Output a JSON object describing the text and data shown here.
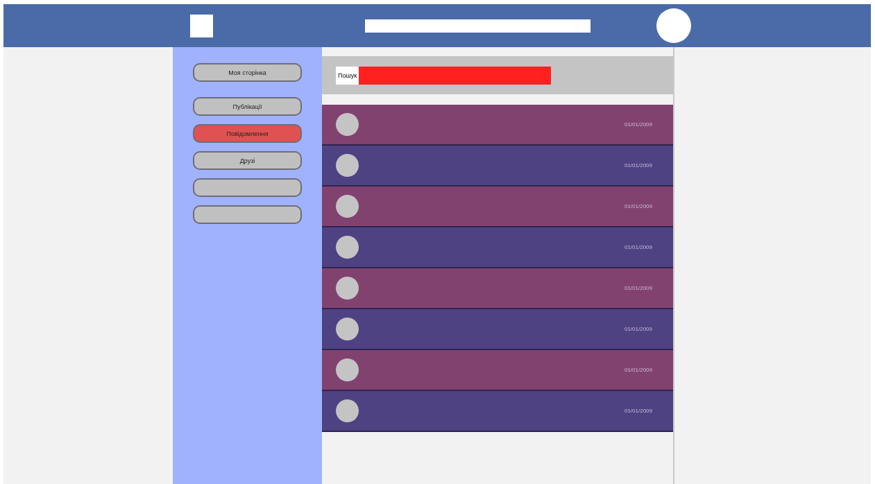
{
  "sidebar": {
    "items": [
      {
        "label": "Моя сторінка",
        "selected": false
      },
      {
        "label": "Публікації",
        "selected": false
      },
      {
        "label": "Повідомлення",
        "selected": true
      },
      {
        "label": "Друзі",
        "selected": false
      },
      {
        "selected": false
      },
      {
        "selected": false
      }
    ]
  },
  "toolbar": {
    "label": "Пошук"
  },
  "messages": [
    {
      "date": "01/01/2009",
      "color": "#82426f"
    },
    {
      "date": "01/01/2009",
      "color": "#4f4283"
    },
    {
      "date": "01/01/2009",
      "color": "#82426f"
    },
    {
      "date": "01/01/2009",
      "color": "#4f4283"
    },
    {
      "date": "01/01/2009",
      "color": "#82426f"
    },
    {
      "date": "01/01/2009",
      "color": "#4f4283"
    },
    {
      "date": "01/01/2009",
      "color": "#82426f"
    },
    {
      "date": "01/01/2009",
      "color": "#4f4283"
    }
  ]
}
